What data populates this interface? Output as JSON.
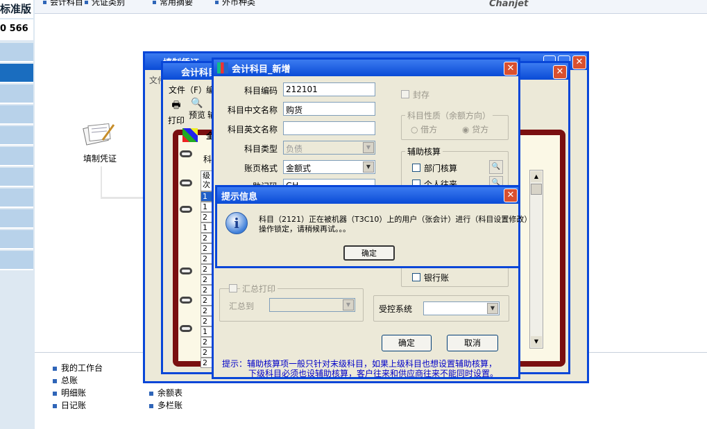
{
  "left_panel": {
    "edition": "标准版",
    "phone": "0 566"
  },
  "top_nav": {
    "items": [
      "会计科目",
      "凭证类别",
      "常用摘要",
      "外币种类"
    ],
    "logo": "Chanjet"
  },
  "desktop": {
    "voucher_icon_label": "填制凭证"
  },
  "bottom_links": {
    "col1": [
      "我的工作台",
      "总账",
      "明细账",
      "日记账"
    ],
    "col2": [
      "余额表",
      "多栏账"
    ]
  },
  "bg_window": {
    "title": "填制凭证",
    "menu_file": "文件"
  },
  "mid_window": {
    "title": "会计科目",
    "menu_file": "文件（F）",
    "menu_edit": "编",
    "toolbar_print": "打印",
    "toolbar_preview": "预览",
    "toolbar_more": "输",
    "tab_all": "全",
    "label_subject": "科",
    "grid_header": "级次",
    "grid_rows": [
      "1",
      "1",
      "2",
      "1",
      "2",
      "2",
      "2",
      "2",
      "2",
      "2",
      "2",
      "2",
      "2",
      "1",
      "2",
      "2",
      "2"
    ]
  },
  "dialog": {
    "title": "会计科目_新增",
    "code_label": "科目编码",
    "code_value": "212101",
    "cn_name_label": "科目中文名称",
    "cn_name_value": "购货",
    "en_name_label": "科目英文名称",
    "en_name_value": "",
    "type_label": "科目类型",
    "type_value": "负债",
    "format_label": "账页格式",
    "format_value": "金额式",
    "mnemonic_label": "助记码",
    "mnemonic_value": "GH",
    "seal_label": "封存",
    "nature_group": "科目性质（余额方向）",
    "debit_label": "借方",
    "credit_label": "贷方",
    "aux_group": "辅助核算",
    "dept_label": "部门核算",
    "person_label": "个人往来",
    "bank_label": "银行账",
    "summary_print_label": "汇总打印",
    "summary_to_label": "汇总到",
    "controlled_label": "受控系统",
    "controlled_value": "",
    "ok_label": "确定",
    "cancel_label": "取消",
    "hint_line1": "提示：辅助核算项一般只针对末级科目，如果上级科目也想设置辅助核算，",
    "hint_line2": "下级科目必须也设辅助核算，客户往来和供应商往来不能同时设置。"
  },
  "alert": {
    "title": "提示信息",
    "line1": "科目（2121）正在被机器（T3C10）上的用户（张会计）进行（科目设置修改）",
    "line2": "操作锁定，请稍候再试。。。",
    "ok_label": "确定"
  }
}
